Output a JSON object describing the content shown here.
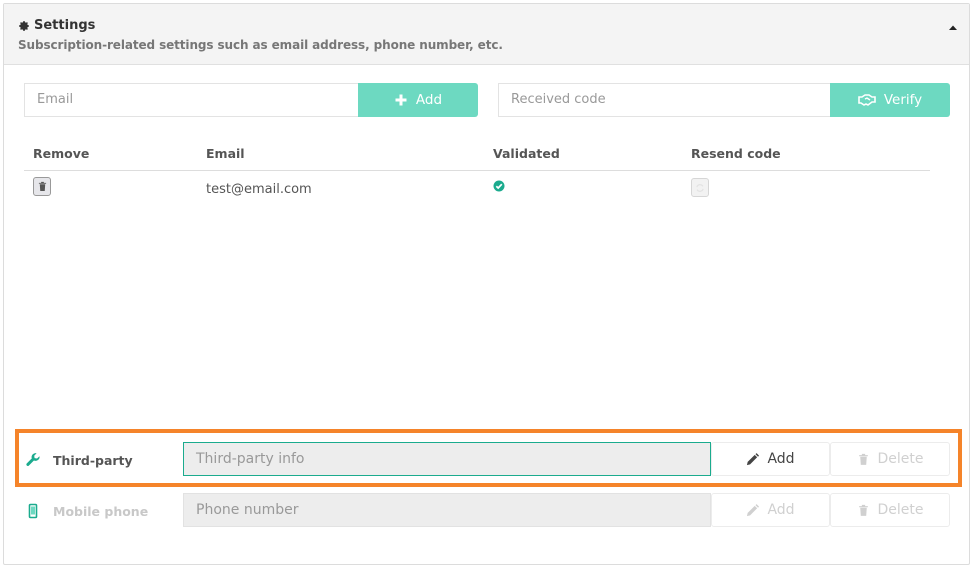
{
  "panel": {
    "title": "Settings",
    "subtitle": "Subscription-related settings such as email address, phone number, etc.",
    "title_icon": "gear-icon",
    "collapse_icon": "caret-up-icon"
  },
  "email_form": {
    "email_placeholder": "Email",
    "add_label": "Add",
    "add_icon": "plus-icon",
    "code_placeholder": "Received code",
    "verify_label": "Verify",
    "verify_icon": "handshake-icon"
  },
  "table": {
    "headers": [
      "Remove",
      "Email",
      "Validated",
      "Resend code"
    ],
    "rows": [
      {
        "email": "test@email.com",
        "validated": true,
        "remove_icon": "trash-icon",
        "resend_icon": "refresh-icon"
      }
    ]
  },
  "third_party": {
    "label": "Third-party",
    "icon": "wrench-icon",
    "placeholder": "Third-party info",
    "add_label": "Add",
    "delete_label": "Delete"
  },
  "mobile_phone": {
    "label": "Mobile phone",
    "icon": "mobile-icon",
    "placeholder": "Phone number",
    "add_label": "Add",
    "delete_label": "Delete"
  },
  "colors": {
    "accent": "#6dd9c1",
    "success": "#1bab8e",
    "highlight": "#f5842a"
  }
}
